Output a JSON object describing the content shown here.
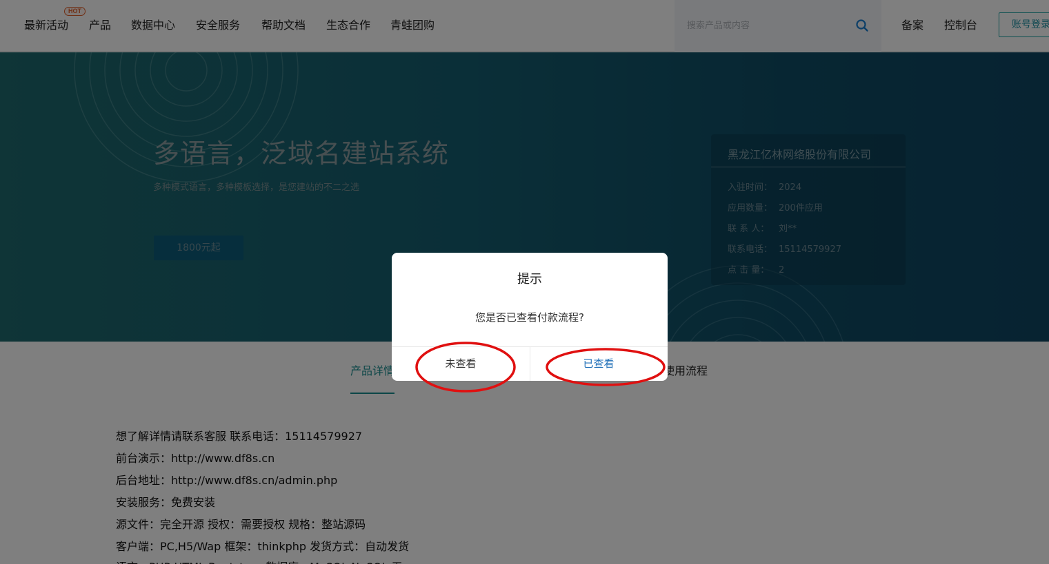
{
  "nav": {
    "items": [
      {
        "label": "最新活动"
      },
      {
        "label": "产品"
      },
      {
        "label": "数据中心"
      },
      {
        "label": "安全服务"
      },
      {
        "label": "帮助文档"
      },
      {
        "label": "生态合作"
      },
      {
        "label": "青蛙团购"
      }
    ],
    "hot_badge": "HOT",
    "search_placeholder": "搜索产品或内容",
    "search_icon": "search-icon",
    "right_links": [
      "备案",
      "控制台"
    ],
    "login_label": "账号登录"
  },
  "hero": {
    "title": "多语言，泛域名建站系统",
    "subtitle": "多种模式语言，多种模板选择，是您建站的不二之选",
    "price_label": "1800元起"
  },
  "company": {
    "name": "黑龙江亿林网络股份有限公司",
    "rows": [
      {
        "label": "入驻时间：",
        "value": "2024"
      },
      {
        "label": "应用数量：",
        "value": "200件应用"
      },
      {
        "label": "联 系 人：",
        "value": "刘**"
      },
      {
        "label": "联系电话：",
        "value": "15114579927"
      },
      {
        "label": "点 击 量：",
        "value": "2"
      }
    ]
  },
  "tabs": {
    "active": "产品详情",
    "partial_label": "使用流程"
  },
  "details": [
    "想了解详情请联系客服 联系电话：15114579927",
    "前台演示：http://www.df8s.cn",
    "后台地址：http://www.df8s.cn/admin.php",
    "安装服务：免费安装",
    "源文件：完全开源 授权：需要授权 规格：整站源码",
    "客户端：PC,H5/Wap 框架：thinkphp 发货方式：自动发货",
    "语言：PHP,HTML,Bootstrap 数据库：MySQL,NoSQL 无"
  ],
  "modal": {
    "title": "提示",
    "message": "您是否已查看付款流程?",
    "cancel_label": "未查看",
    "confirm_label": "已查看"
  },
  "colors": {
    "accent": "#178c8f",
    "confirm": "#1f6fb8",
    "annotation": "#e01010"
  }
}
